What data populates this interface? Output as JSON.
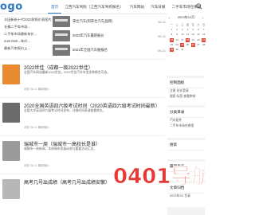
{
  "logo": "ogo",
  "nav": [
    {
      "label": "首页",
      "active": true
    },
    {
      "label": "江西汽车驾照（江西汽车驾校报名）"
    },
    {
      "label": "汽车网站"
    },
    {
      "label": "汽车日报"
    },
    {
      "label": "二手车市场在哪里"
    }
  ],
  "left_list": [
    "丰田新新十代2022款报价表图片（",
    "车摘要",
    "2022款（图片 价格车）",
    "...",
    "...",
    "最新汽车报价上..."
  ],
  "left_list_full": [
    "丰田新新十代2022款报价表图片（",
    "长春二手车市场...",
    "二手车市场最新车价...",
    "ours Mob...车价...",
    "...",
    "最新汽车报价上..."
  ],
  "mini_items": [
    {
      "title": "宋仕汽车(阿宋仕汽车品牌)",
      "date": "06-11"
    },
    {
      "title": "2022年汽车最新报价",
      "date": "06-11"
    },
    {
      "title": "2021年全国汽车展报名",
      "date": "06-11"
    }
  ],
  "posts": [
    {
      "title": "2022世佳（成都一级2022世佳）",
      "text": "全国汽车网站最新2022世佳，2022世佳汽车车型多种颜色可选。",
      "meta": "浏览 06-11 最新报价"
    },
    {
      "title": "2020全国英语四六级考试时间（2020英语四六级考试时间最新）",
      "text": "全国大学英语四六级考试时间发布，详细时间表请查看原文。",
      "meta": "浏览 06-11 最新报价"
    },
    {
      "title": "瑞城市一周（瑞城市一高校长是谁）",
      "text": "瑞城市一周新闻，本周城市发展动态与重要活动汇总。",
      "meta": "浏览 06-11 最新报价"
    },
    {
      "title": "高考几号出成绩（高考几号出成绩安徽）",
      "text": "",
      "meta": ""
    }
  ],
  "calendar": {
    "title": "2023年12月",
    "days": [
      "一",
      "二",
      "三",
      "四",
      "五",
      "六",
      "日"
    ],
    "highlight": [
      15,
      18,
      21,
      24,
      26,
      29
    ]
  },
  "sidebar_boxes": [
    {
      "title": "控制面板",
      "lines": [
        "注册 站长登录 ",
        "搜索 标签 查看审核"
      ]
    },
    {
      "title": "分类目录",
      "lines": [
        "汽车配件",
        "二手车市场在哪里"
      ]
    },
    {
      "title": "搜索",
      "lines": [
        "..."
      ]
    },
    {
      "title": "最新发表",
      "lines": [
        "2023年9月 发布"
      ]
    },
    {
      "title": "文章归档",
      "lines": [
        "2023年XX 目录"
      ]
    }
  ],
  "ad": {
    "text": "0401导航"
  }
}
